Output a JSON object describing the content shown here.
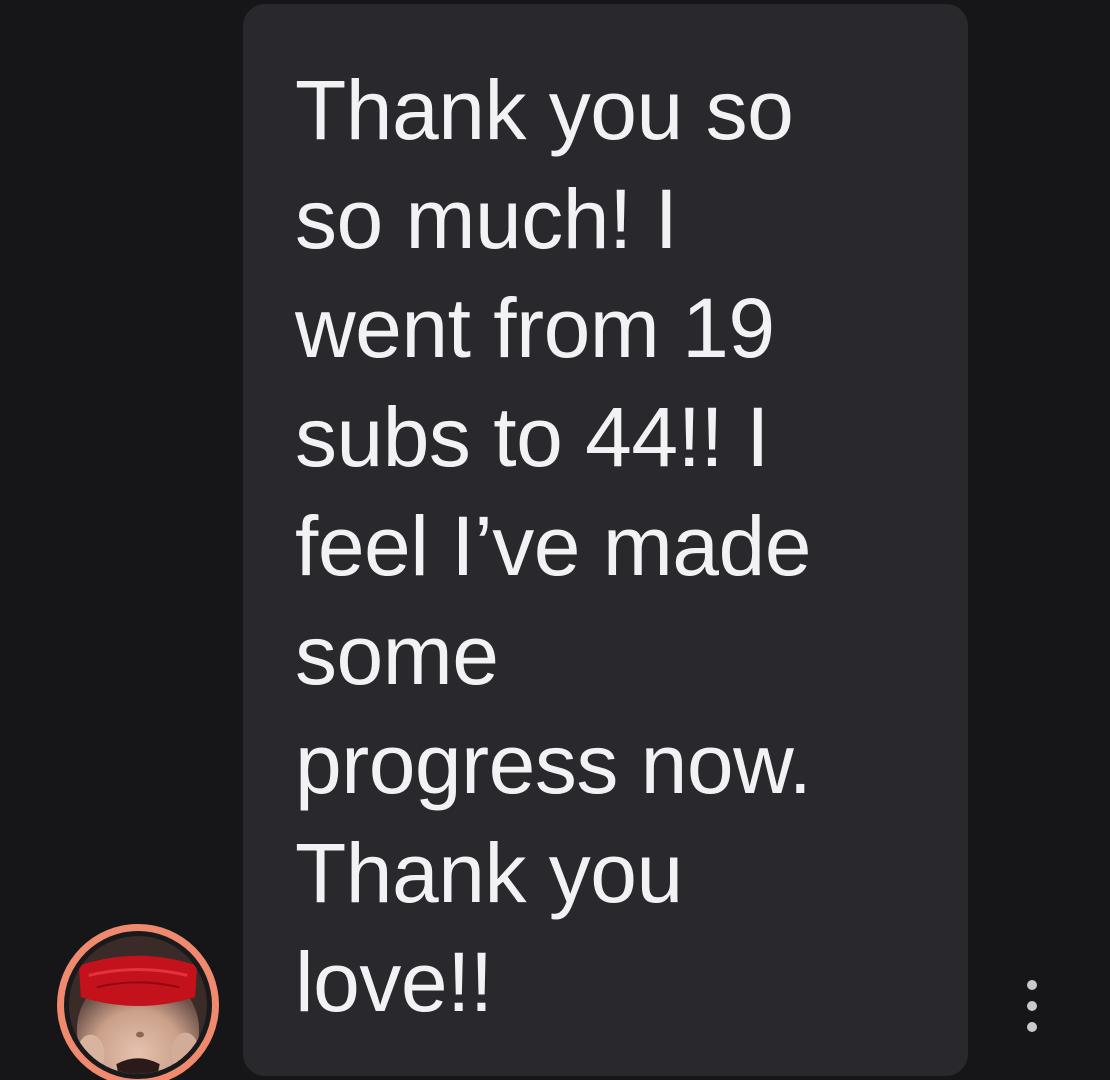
{
  "message": {
    "text": "Thank you so\nso much! I\nwent from 19\nsubs to 44!! I\nfeel I’ve made\nsome\nprogress now.\nThank you\nlove!!"
  },
  "avatar": {
    "ring_color": "#f08a6e"
  },
  "actions": {
    "more_icon": "more-options-icon"
  },
  "colors": {
    "background": "#161618",
    "bubble": "#29292d",
    "text": "#f2f2f4"
  }
}
